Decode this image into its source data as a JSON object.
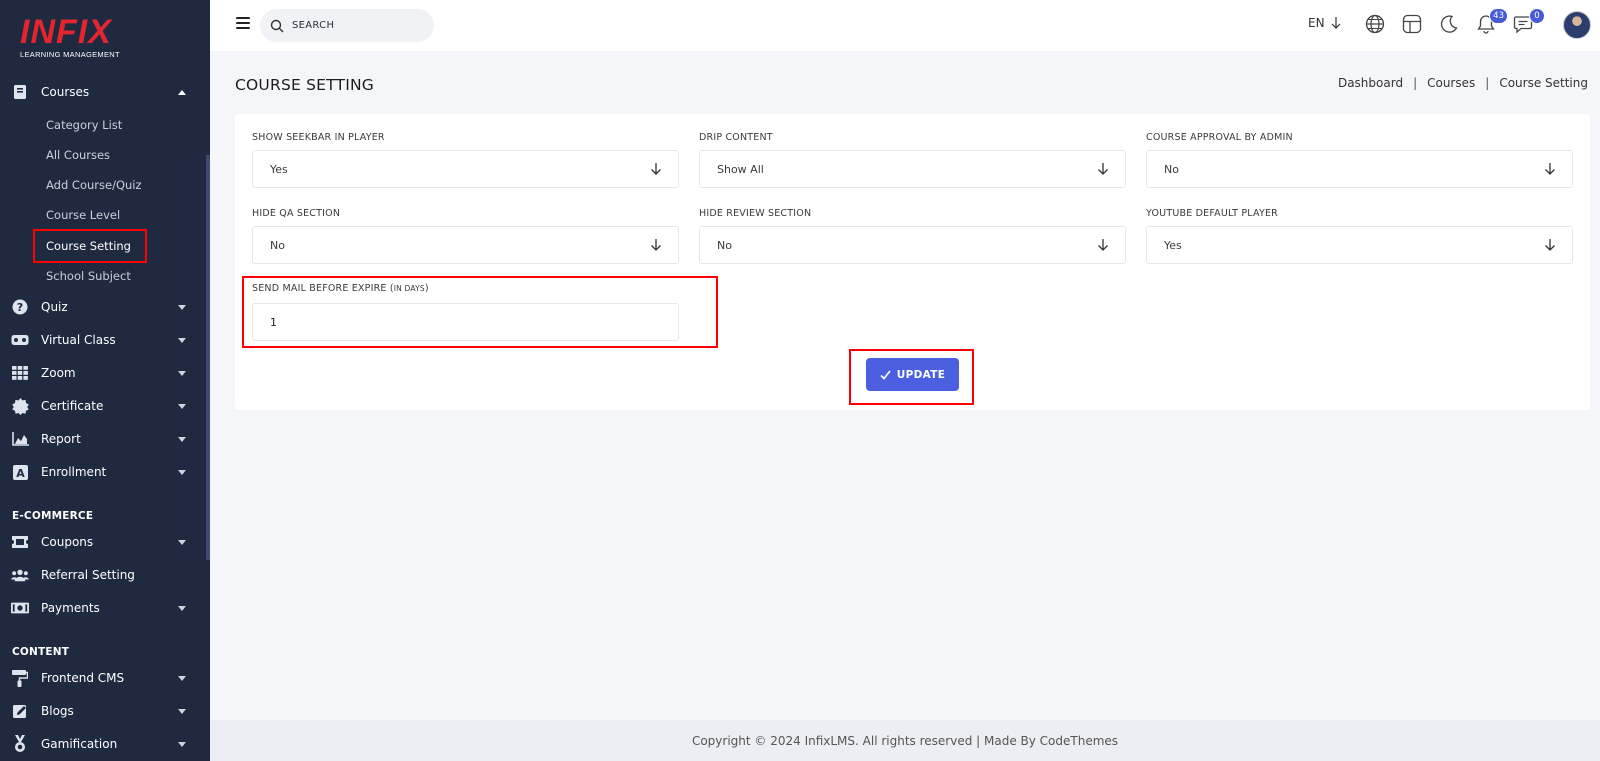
{
  "brand": {
    "logo_text": "INFIX",
    "logo_subtitle": "LEARNING MANAGEMENT",
    "color": "#e3262e"
  },
  "sidebar": {
    "courses": {
      "label": "Courses",
      "icon": "book-icon",
      "expanded": true,
      "children": [
        "Category List",
        "All Courses",
        "Add Course/Quiz",
        "Course Level",
        "Course Setting",
        "School Subject"
      ],
      "active_child": "Course Setting"
    },
    "items": [
      {
        "label": "Quiz",
        "icon": "question-circle-icon"
      },
      {
        "label": "Virtual Class",
        "icon": "vr-headset-icon"
      },
      {
        "label": "Zoom",
        "icon": "grid-icon"
      },
      {
        "label": "Certificate",
        "icon": "certificate-icon"
      },
      {
        "label": "Report",
        "icon": "chart-area-icon"
      },
      {
        "label": "Enrollment",
        "icon": "enrollment-icon"
      }
    ],
    "section_ecommerce": "E-COMMERCE",
    "ecommerce_items": [
      {
        "label": "Coupons",
        "icon": "ticket-icon"
      },
      {
        "label": "Referral Setting",
        "icon": "users-icon"
      },
      {
        "label": "Payments",
        "icon": "money-icon"
      }
    ],
    "section_content": "CONTENT",
    "content_items": [
      {
        "label": "Frontend CMS",
        "icon": "paint-roller-icon"
      },
      {
        "label": "Blogs",
        "icon": "edit-icon"
      },
      {
        "label": "Gamification",
        "icon": "medal-icon"
      }
    ]
  },
  "header": {
    "search_placeholder": "SEARCH",
    "language": "EN",
    "notification_count": "43",
    "message_count": "0"
  },
  "page": {
    "title": "COURSE SETTING",
    "breadcrumb": [
      "Dashboard",
      "Courses",
      "Course Setting"
    ]
  },
  "form": {
    "show_seekbar": {
      "label": "SHOW SEEKBAR IN PLAYER",
      "value": "Yes"
    },
    "drip_content": {
      "label": "DRIP CONTENT",
      "value": "Show All"
    },
    "course_approval": {
      "label": "COURSE APPROVAL BY ADMIN",
      "value": "No"
    },
    "hide_qa": {
      "label": "HIDE QA SECTION",
      "value": "No"
    },
    "hide_review": {
      "label": "HIDE REVIEW SECTION",
      "value": "No"
    },
    "youtube_player": {
      "label": "YOUTUBE DEFAULT PLAYER",
      "value": "Yes"
    },
    "send_mail": {
      "label": "SEND MAIL BEFORE EXPIRE (",
      "label_small": "IN DAYS",
      "label_close": ")",
      "value": "1"
    },
    "update_label": "UPDATE"
  },
  "footer": {
    "text": "Copyright © 2024 InfixLMS. All rights reserved | Made By CodeThemes"
  },
  "colors": {
    "sidebar_bg": "#1f2940",
    "accent": "#4c5fe0",
    "highlight": "#ff0000"
  }
}
